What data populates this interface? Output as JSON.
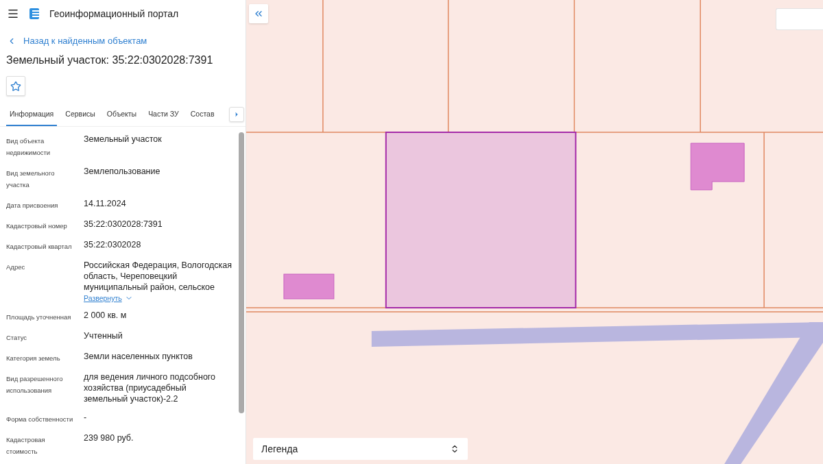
{
  "header": {
    "title": "Геоинформационный портал"
  },
  "back_link": "Назад к найденным объектам",
  "heading": "Земельный участок: 35:22:0302028:7391",
  "tabs": [
    {
      "label": "Информация",
      "selected": true
    },
    {
      "label": "Сервисы",
      "selected": false
    },
    {
      "label": "Объекты",
      "selected": false
    },
    {
      "label": "Части ЗУ",
      "selected": false
    },
    {
      "label": "Состав",
      "selected": false
    }
  ],
  "properties": [
    {
      "label": "Вид объекта недвижимости",
      "value": "Земельный участок"
    },
    {
      "label": "Вид земельного участка",
      "value": "Землепользование"
    },
    {
      "label": "Дата присвоения",
      "value": "14.11.2024"
    },
    {
      "label": "Кадастровый номер",
      "value": "35:22:0302028:7391"
    },
    {
      "label": "Кадастровый квартал",
      "value": "35:22:0302028"
    },
    {
      "label": "Адрес",
      "value": "Российская Федерация, Вологодская область, Череповецкий муниципальный район, сельское",
      "expand_link": "Развернуть"
    },
    {
      "label": "Площадь уточненная",
      "value": "2 000 кв. м"
    },
    {
      "label": "Статус",
      "value": "Учтенный"
    },
    {
      "label": "Категория земель",
      "value": "Земли населенных пунктов"
    },
    {
      "label": "Вид разрешенного использования",
      "value": "для ведения личного подсобного хозяйства (приусадебный земельный участок)-2.2"
    },
    {
      "label": "Форма собственности",
      "value": "-"
    },
    {
      "label": "Кадастровая стоимость",
      "value": "239 980 руб."
    }
  ],
  "legend": {
    "label": "Легенда"
  }
}
